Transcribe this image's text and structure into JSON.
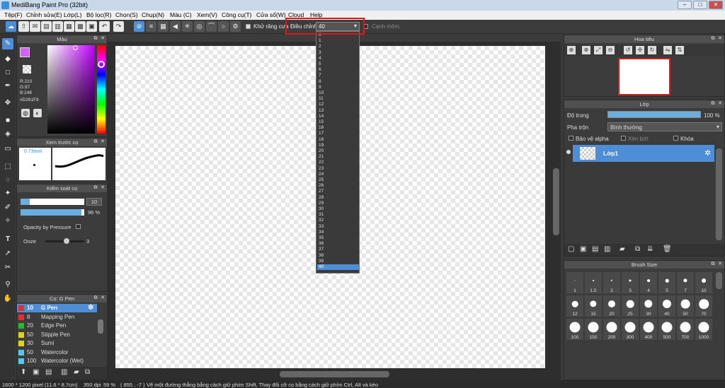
{
  "window": {
    "title": "MediBang Paint Pro (32bit)",
    "min": "–",
    "max": "□",
    "close": "✕"
  },
  "menu": [
    "Tệp(F)",
    "Chỉnh sửa(E)",
    "Lớp(L)",
    "Bộ lọc(R)",
    "Chọn(S)",
    "Chụp(N)",
    "Màu (C)",
    "Xem(V)",
    "Công cụ(T)",
    "Cửa sổ(W)",
    "Cloud",
    "Help"
  ],
  "toolbar": {
    "antialias_label": "Khử răng cưa",
    "adjust_label": "Điều chỉnh",
    "adjust_value": "40",
    "soft_edge_label": "Cạnh mềm"
  },
  "dropdown_options": [
    "0",
    "1",
    "2",
    "3",
    "4",
    "5",
    "6",
    "7",
    "8",
    "9",
    "10",
    "11",
    "12",
    "13",
    "14",
    "15",
    "16",
    "17",
    "18",
    "19",
    "20",
    "21",
    "22",
    "23",
    "24",
    "25",
    "26",
    "27",
    "28",
    "29",
    "30",
    "31",
    "32",
    "33",
    "34",
    "35",
    "36",
    "37",
    "38",
    "39",
    "40"
  ],
  "color_panel": {
    "title": "Màu",
    "r": "R:210",
    "g": "G:97",
    "b": "B:248",
    "hex": "#D261F8",
    "fg_color": "#D261F8"
  },
  "brush_preview": {
    "title": "Xem trước cọ",
    "size": "0.73mm"
  },
  "brush_control": {
    "title": "Kiểm soát cọ",
    "size_value": "10",
    "opacity_value": "96 %",
    "opacity_pressure_label": "Opacity by Pressure",
    "ooze_label": "Ooze",
    "ooze_value": "3",
    "size_fill": 0.14,
    "opacity_fill": 0.96,
    "ooze_fill": 0.55
  },
  "brush_list": {
    "title": "Cọ: G Pen",
    "items": [
      {
        "size": "10",
        "name": "G Pen",
        "color": "#e03030",
        "selected": true
      },
      {
        "size": "8",
        "name": "Mapping Pen",
        "color": "#e03030",
        "selected": false
      },
      {
        "size": "20",
        "name": "Edge Pen",
        "color": "#2db52d",
        "selected": false
      },
      {
        "size": "50",
        "name": "Stipple Pen",
        "color": "#e0d020",
        "selected": false
      },
      {
        "size": "30",
        "name": "Sumi",
        "color": "#e0d020",
        "selected": false
      },
      {
        "size": "50",
        "name": "Watercolor",
        "color": "#55c8ee",
        "selected": false
      },
      {
        "size": "100",
        "name": "Watercolor (Wet)",
        "color": "#55c8ee",
        "selected": false
      }
    ]
  },
  "canvas": {
    "tab_title": "Untitled"
  },
  "navigator": {
    "title": "Hoa tiêu"
  },
  "layer_panel": {
    "title": "Lớp",
    "opacity_label": "Độ trong",
    "opacity_value": "100 %",
    "opacity_fill": 1.0,
    "blend_label": "Pha trộn",
    "blend_value": "Bình thường",
    "protect_alpha": "Bảo vệ alpha",
    "clipping": "Xén bớt",
    "lock": "Khóa",
    "layer_name": "Lớp1"
  },
  "brush_size": {
    "title": "Brush Size",
    "sizes": [
      "1",
      "1.5",
      "2",
      "3",
      "4",
      "5",
      "7",
      "10",
      "12",
      "15",
      "20",
      "25",
      "30",
      "40",
      "50",
      "70",
      "100",
      "150",
      "200",
      "300",
      "400",
      "500",
      "700",
      "1000"
    ]
  },
  "status": {
    "pixel": "1600 * 1200 pixel",
    "cm": "(11.6 * 8.7cm)",
    "dpi": "350 dpi",
    "zoom": "59 %",
    "coords": "( 855 , -7 )",
    "hint": "Vẽ một đường thẳng bằng cách giữ phím Shift, Thay đổi cỡ cọ bằng cách giữ phím Ctrl, Alt và kéo"
  }
}
